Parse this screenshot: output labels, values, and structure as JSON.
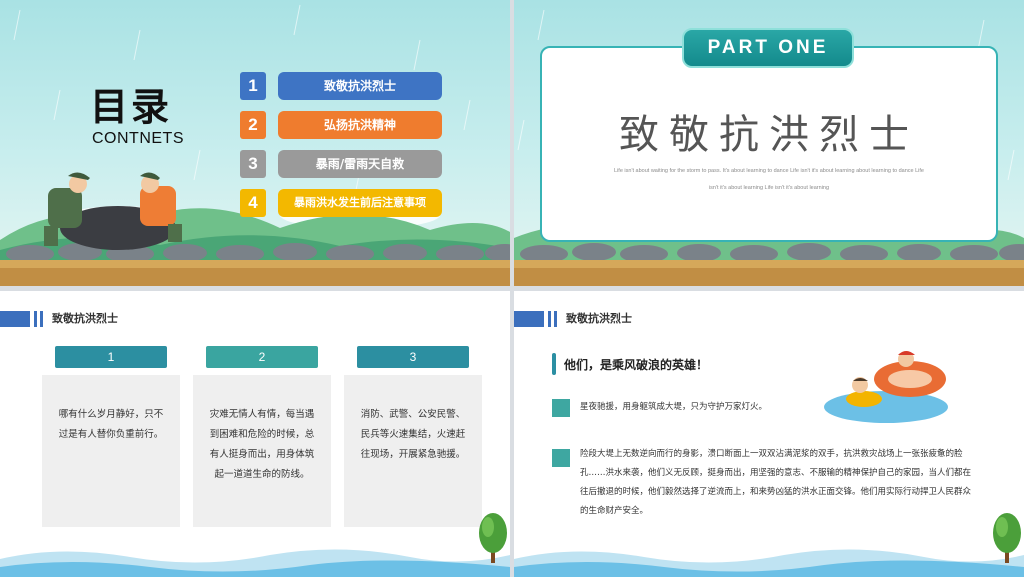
{
  "slide1": {
    "title": "目录",
    "subtitle": "CONTNETS",
    "items": [
      {
        "num": "1",
        "label": "致敬抗洪烈士",
        "color": "#3e74c4"
      },
      {
        "num": "2",
        "label": "弘扬抗洪精神",
        "color": "#ef7c2e"
      },
      {
        "num": "3",
        "label": "暴雨/雷雨天自救",
        "color": "#9a9a9a"
      },
      {
        "num": "4",
        "label": "暴雨洪水发生前后注意事项",
        "color": "#f3b800"
      }
    ]
  },
  "slide2": {
    "badge": "PART ONE",
    "title": "致敬抗洪烈士",
    "fine_line1": "Life isn't about waiting for the storm to pass. It's about learning to dance Life isn't it's about learning about learning to dance Life",
    "fine_line2": "isn't it's about learning Life isn't it's about learning"
  },
  "slide3": {
    "section_title": "致敬抗洪烈士",
    "columns": [
      {
        "num": "1",
        "text": "哪有什么岁月静好，只不过是有人替你负重前行。"
      },
      {
        "num": "2",
        "text": "灾难无情人有情，每当遇到困难和危险的时候，总有人挺身而出，用身体筑起一道道生命的防线。"
      },
      {
        "num": "3",
        "text": "消防、武警、公安民警、民兵等火速集结，火速赶往现场，开展紧急驰援。"
      }
    ]
  },
  "slide4": {
    "section_title": "致敬抗洪烈士",
    "headline": "他们，是乘风破浪的英雄！",
    "point1": "星夜驰援，用身躯筑成大堤，只为守护万家灯火。",
    "point2": "险段大堤上无数逆向而行的身影，溃口断面上一双双沾满泥浆的双手，抗洪救灾战场上一张张疲惫的脸孔……洪水来袭，他们义无反顾，挺身而出，用坚强的意志、不服输的精神保护自己的家园，当人们都在往后撤退的时候，他们毅然选择了逆流而上，和来势凶猛的洪水正面交锋。他们用实际行动捍卫人民群众的生命财产安全。"
  }
}
